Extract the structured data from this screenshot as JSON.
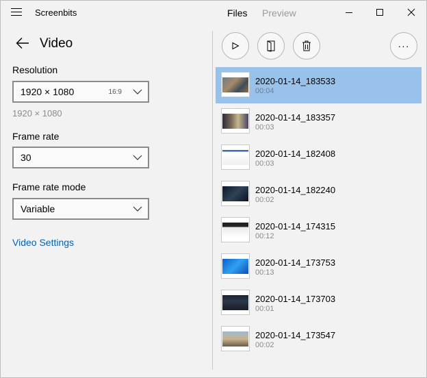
{
  "titlebar": {
    "app_title": "Screenbits",
    "nav_files": "Files",
    "nav_preview": "Preview"
  },
  "page": {
    "title": "Video"
  },
  "settings": {
    "resolution_label": "Resolution",
    "resolution_value": "1920 × 1080",
    "resolution_ratio": "16:9",
    "resolution_subtext": "1920 × 1080",
    "framerate_label": "Frame rate",
    "framerate_value": "30",
    "framerate_mode_label": "Frame rate mode",
    "framerate_mode_value": "Variable",
    "video_settings_link": "Video Settings"
  },
  "toolbar": {
    "more_label": "···"
  },
  "files": [
    {
      "name": "2020-01-14_183533",
      "duration": "00:04",
      "selected": true,
      "thumb": "game-scene"
    },
    {
      "name": "2020-01-14_183357",
      "duration": "00:03",
      "selected": false,
      "thumb": "game-menu"
    },
    {
      "name": "2020-01-14_182408",
      "duration": "00:03",
      "selected": false,
      "thumb": "document"
    },
    {
      "name": "2020-01-14_182240",
      "duration": "00:02",
      "selected": false,
      "thumb": "dark-game"
    },
    {
      "name": "2020-01-14_174315",
      "duration": "00:12",
      "selected": false,
      "thumb": "website"
    },
    {
      "name": "2020-01-14_173753",
      "duration": "00:13",
      "selected": false,
      "thumb": "desktop"
    },
    {
      "name": "2020-01-14_173703",
      "duration": "00:01",
      "selected": false,
      "thumb": "dark-app"
    },
    {
      "name": "2020-01-14_173547",
      "duration": "00:02",
      "selected": false,
      "thumb": "game-outdoor"
    }
  ],
  "colors": {
    "selection": "#99c2ea",
    "link": "#0063b1",
    "background": "#f2f2f2"
  }
}
